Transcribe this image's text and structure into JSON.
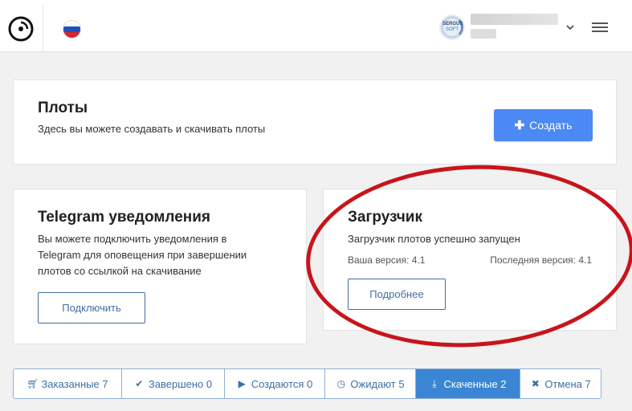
{
  "header": {
    "logo_icon": "vinyl-disc-logo",
    "language_flag": "russia-flag-icon",
    "avatar_text_line1": "SERGUS",
    "avatar_text_line2": "SOFT",
    "user_menu_icon": "chevron-down-icon",
    "menu_icon": "hamburger-menu-icon"
  },
  "plots_card": {
    "title": "Плоты",
    "description": "Здесь вы можете создавать и скачивать плоты",
    "create_button": "Создать",
    "create_icon": "plus-icon"
  },
  "telegram_card": {
    "title": "Telegram уведомления",
    "description_lines": [
      "Вы можете подключить уведомления в",
      "Telegram для оповещения при завершении",
      "плотов со ссылкой на скачивание"
    ],
    "connect_button": "Подключить"
  },
  "downloader_card": {
    "title": "Загрузчик",
    "status": "Загрузчик плотов успешно запущен",
    "your_version": "Ваша версия: 4.1",
    "latest_version": "Последняя версия: 4.1",
    "details_button": "Подробнее"
  },
  "tabs": [
    {
      "label": "Заказанные 7",
      "icon": "cart-icon",
      "active": false
    },
    {
      "label": "Завершено 0",
      "icon": "check-icon",
      "active": false
    },
    {
      "label": "Создаются 0",
      "icon": "play-icon",
      "active": false
    },
    {
      "label": "Ожидают 5",
      "icon": "clock-icon",
      "active": false
    },
    {
      "label": "Скаченные 2",
      "icon": "download-icon",
      "active": true
    },
    {
      "label": "Отмена 7",
      "icon": "x-icon",
      "active": false
    }
  ],
  "colors": {
    "primary": "#4b89f4",
    "active_tab": "#3a86d4",
    "outline": "#3f6fa6",
    "annotation_red": "#c8141b"
  }
}
